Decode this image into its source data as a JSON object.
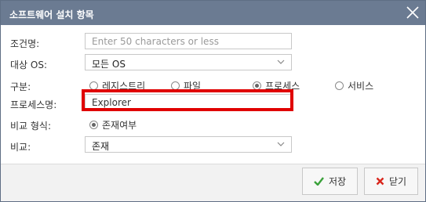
{
  "dialog": {
    "title": "소프트웨어 설치 항목"
  },
  "form": {
    "condition_name": {
      "label": "조건명:",
      "value": "",
      "placeholder": "Enter 50 characters or less"
    },
    "target_os": {
      "label": "대상 OS:",
      "value": "모든 OS"
    },
    "type": {
      "label": "구분:",
      "options": [
        "레지스트리",
        "파일",
        "프로세스",
        "서비스"
      ],
      "selected": "프로세스"
    },
    "process_name": {
      "label": "프로세스명:",
      "value": "Explorer"
    },
    "comparison_format": {
      "label": "비교 형식:",
      "option": "존재여부",
      "selected": true
    },
    "comparison": {
      "label": "비교:",
      "value": "존재"
    }
  },
  "buttons": {
    "save_label": "저장",
    "close_label": "닫기"
  },
  "colors": {
    "titlebar": "#6b7b92",
    "highlight": "#e00000",
    "save_icon": "#3aa13a",
    "close_icon": "#d9261c"
  },
  "icons": {
    "close": "close-icon",
    "dropdown": "chevron-down-icon",
    "save": "check-icon",
    "cancel": "x-icon"
  }
}
